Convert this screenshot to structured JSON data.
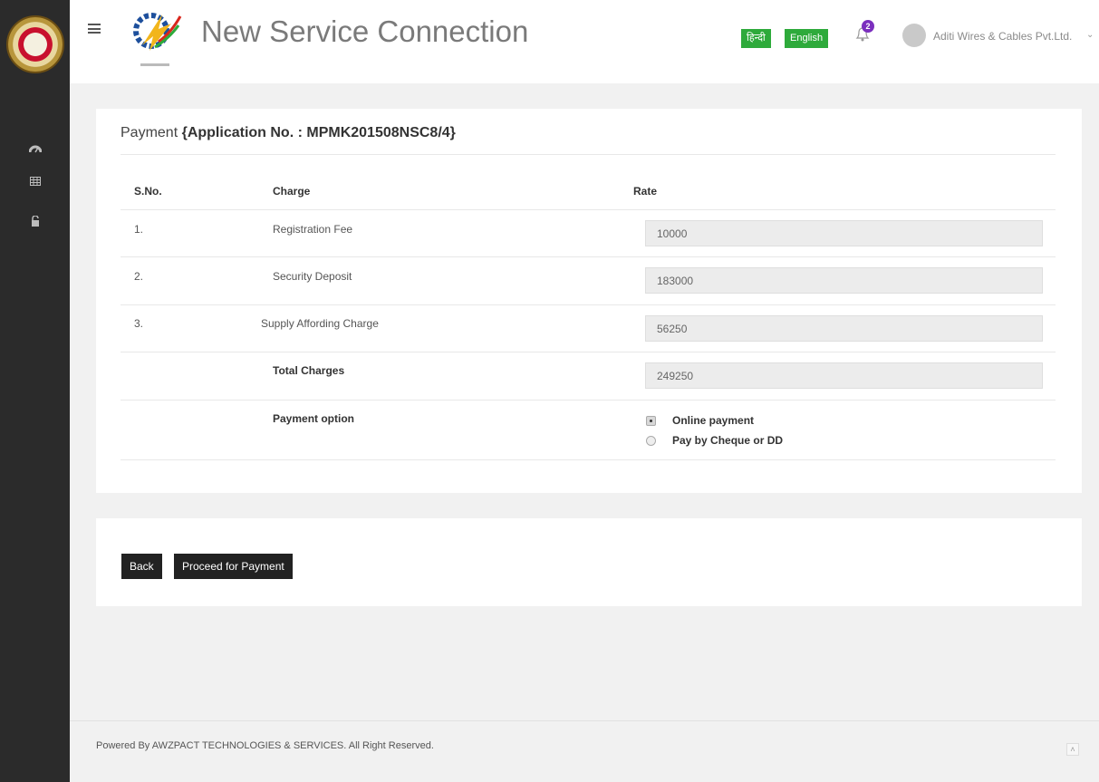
{
  "header": {
    "title": "New Service Connection",
    "logo_icon": "lightning-gear-logo",
    "lang_hindi": "हिन्दी",
    "lang_english": "English",
    "notification_count": "2",
    "user_name": "Aditi Wires & Cables Pvt.Ltd.",
    "lang_color": "#2eaa3b",
    "badge_color": "#7b2fbe"
  },
  "sidebar": {
    "emblem": "state-emblem",
    "items": [
      {
        "icon": "dashboard-icon",
        "glyph": "✇"
      },
      {
        "icon": "table-icon",
        "glyph": "▦"
      },
      {
        "icon": "unlock-icon",
        "glyph": "🔓"
      }
    ]
  },
  "payment": {
    "title_prefix": "Payment",
    "title_app": "{Application No. : MPMK201508NSC8/4}",
    "columns": {
      "sno": "S.No.",
      "charge": "Charge",
      "rate": "Rate"
    },
    "rows": [
      {
        "sno": "1.",
        "charge": "Registration Fee",
        "rate": "10000"
      },
      {
        "sno": "2.",
        "charge": "Security Deposit",
        "rate": "183000"
      },
      {
        "sno": "3.",
        "charge": "Supply Affording Charge",
        "rate": "56250"
      }
    ],
    "total_label": "Total Charges",
    "total_value": "249250",
    "option_label": "Payment option",
    "options": [
      {
        "label": "Online payment",
        "selected": true
      },
      {
        "label": "Pay by Cheque or DD",
        "selected": false
      }
    ]
  },
  "actions": {
    "back": "Back",
    "proceed": "Proceed for Payment"
  },
  "footer": {
    "text": "Powered By AWZPACT TECHNOLOGIES & SERVICES. All Right Reserved.",
    "scroll_top": "^"
  }
}
